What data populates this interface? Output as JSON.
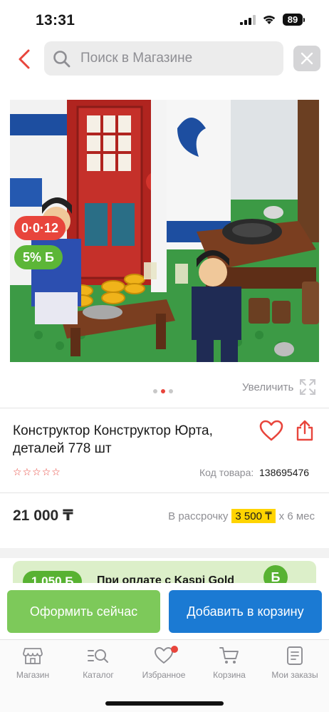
{
  "status_bar": {
    "time": "13:31",
    "battery": "89"
  },
  "search": {
    "placeholder": "Поиск в Магазине"
  },
  "product": {
    "badge_timer": "0·0·12",
    "badge_bonus": "5% Б",
    "gallery_pages": 3,
    "gallery_active": 2,
    "zoom_label": "Увеличить",
    "title": "Конструктор Конструктор Юрта, деталей 778 шт",
    "rating_stars": 5,
    "code_label": "Код товара:",
    "code_value": "138695476",
    "price": "21 000 ₸",
    "installment_prefix": "В рассрочку",
    "installment_amount": "3 500 ₸",
    "installment_suffix": "х 6 мес"
  },
  "promo": {
    "badge": "1 050 Б",
    "text": "При оплате с Kaspi Gold"
  },
  "actions": {
    "checkout_label": "Оформить сейчас",
    "add_to_cart_label": "Добавить в корзину"
  },
  "tabs": [
    {
      "label": "Магазин",
      "icon": "store-icon"
    },
    {
      "label": "Каталог",
      "icon": "catalog-search-icon"
    },
    {
      "label": "Избранное",
      "icon": "heart-icon"
    },
    {
      "label": "Корзина",
      "icon": "cart-icon"
    },
    {
      "label": "Мои заказы",
      "icon": "orders-icon"
    }
  ],
  "colors": {
    "accent_red": "#e8453c",
    "checkout_green": "#7dc95a",
    "cart_blue": "#1b7ad3",
    "installment_yellow": "#ffd400"
  }
}
